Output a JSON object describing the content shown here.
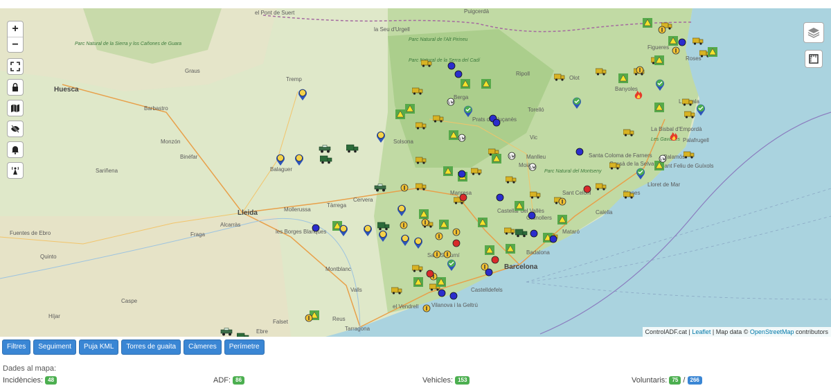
{
  "map": {
    "attribution": {
      "site": "ControlADF.cat",
      "sep1": " | ",
      "leaflet": "Leaflet",
      "mapdata": " | Map data © ",
      "osm": "OpenStreetMap",
      "contrib": " contributors"
    },
    "controls": {
      "zoom_in": "+",
      "zoom_out": "−"
    },
    "places": [
      {
        "name": "Puigcerdà",
        "cls": ""
      },
      {
        "name": "el Pont de Suert",
        "cls": ""
      },
      {
        "name": "la Seu d'Urgell",
        "cls": ""
      },
      {
        "name": "Parc Natural de l'Alt Pirineu",
        "cls": "park"
      },
      {
        "name": "Parc Natural de la Serra del Cadí",
        "cls": "park"
      },
      {
        "name": "Parc Natural de la Sierra y los Cañones de Guara",
        "cls": "park"
      },
      {
        "name": "Graus",
        "cls": ""
      },
      {
        "name": "Huesca",
        "cls": "big"
      },
      {
        "name": "Barbastro",
        "cls": ""
      },
      {
        "name": "Monzón",
        "cls": ""
      },
      {
        "name": "Binéfar",
        "cls": ""
      },
      {
        "name": "Sariñena",
        "cls": ""
      },
      {
        "name": "Tremp",
        "cls": ""
      },
      {
        "name": "Balaguer",
        "cls": ""
      },
      {
        "name": "Lleida",
        "cls": "big"
      },
      {
        "name": "Fraga",
        "cls": ""
      },
      {
        "name": "Alcarràs",
        "cls": ""
      },
      {
        "name": "Fuentes de Ebro",
        "cls": ""
      },
      {
        "name": "Quinto",
        "cls": ""
      },
      {
        "name": "Caspe",
        "cls": ""
      },
      {
        "name": "Híjar",
        "cls": ""
      },
      {
        "name": "les Borges Blanques",
        "cls": ""
      },
      {
        "name": "Mollerussa",
        "cls": ""
      },
      {
        "name": "Tàrrega",
        "cls": ""
      },
      {
        "name": "Cervera",
        "cls": ""
      },
      {
        "name": "Montblanc",
        "cls": ""
      },
      {
        "name": "Valls",
        "cls": ""
      },
      {
        "name": "Falset",
        "cls": ""
      },
      {
        "name": "Reus",
        "cls": ""
      },
      {
        "name": "Tarragona",
        "cls": ""
      },
      {
        "name": "Ebre",
        "cls": ""
      },
      {
        "name": "Solsona",
        "cls": ""
      },
      {
        "name": "Berga",
        "cls": ""
      },
      {
        "name": "Ripoll",
        "cls": ""
      },
      {
        "name": "Olot",
        "cls": ""
      },
      {
        "name": "Prats de Lluçanès",
        "cls": ""
      },
      {
        "name": "Torelló",
        "cls": ""
      },
      {
        "name": "Vic",
        "cls": ""
      },
      {
        "name": "Manlleu",
        "cls": ""
      },
      {
        "name": "Moià",
        "cls": ""
      },
      {
        "name": "Manresa",
        "cls": ""
      },
      {
        "name": "Parc Natural del Montseny",
        "cls": "park"
      },
      {
        "name": "Sant Celoni",
        "cls": ""
      },
      {
        "name": "Castellar del Vallès",
        "cls": ""
      },
      {
        "name": "Granollers",
        "cls": ""
      },
      {
        "name": "Mataró",
        "cls": ""
      },
      {
        "name": "Calella",
        "cls": ""
      },
      {
        "name": "Badalona",
        "cls": ""
      },
      {
        "name": "Barcelona",
        "cls": "big"
      },
      {
        "name": "Sant Sadurní",
        "cls": ""
      },
      {
        "name": "Castelldefels",
        "cls": ""
      },
      {
        "name": "Vilanova i la Geltrú",
        "cls": ""
      },
      {
        "name": "el Vendrell",
        "cls": ""
      },
      {
        "name": "Santa Coloma de Farners",
        "cls": ""
      },
      {
        "name": "Cassà de la Selva",
        "cls": ""
      },
      {
        "name": "Palafrugell",
        "cls": ""
      },
      {
        "name": "Palamós",
        "cls": ""
      },
      {
        "name": "Sant Feliu de Guíxols",
        "cls": ""
      },
      {
        "name": "La Bisbal d'Empordà",
        "cls": ""
      },
      {
        "name": "Banyoles",
        "cls": ""
      },
      {
        "name": "Roses",
        "cls": ""
      },
      {
        "name": "L'Escala",
        "cls": ""
      },
      {
        "name": "Figueres",
        "cls": ""
      },
      {
        "name": "Les Gavarres",
        "cls": "park"
      },
      {
        "name": "Lloret de Mar",
        "cls": ""
      },
      {
        "name": "Blanes",
        "cls": ""
      }
    ]
  },
  "toolbar": {
    "buttons": [
      "Filtres",
      "Seguiment",
      "Puja KML",
      "Torres de guaita",
      "Càmeres",
      "Perímetre"
    ]
  },
  "summary": {
    "title": "Dades al mapa:",
    "incidencies_label": "Incidències:",
    "incidencies": "48",
    "adf_label": "ADF:",
    "adf": "86",
    "vehicles_label": "Vehicles:",
    "vehicles": "153",
    "voluntaris_label": "Voluntaris:",
    "voluntaris_a": "75",
    "voluntaris_sep": "/",
    "voluntaris_b": "266"
  },
  "colors": {
    "sea": "#aad3df",
    "land": "#d3e6b9",
    "button": "#3a86d4",
    "badge_green": "#4caf50"
  },
  "icons": {
    "controls": [
      "fullscreen-icon",
      "lock-icon",
      "map-icon",
      "eye-off-icon",
      "bell-icon",
      "radio-tower-icon"
    ],
    "right": [
      "layers-icon",
      "measure-icon"
    ]
  }
}
